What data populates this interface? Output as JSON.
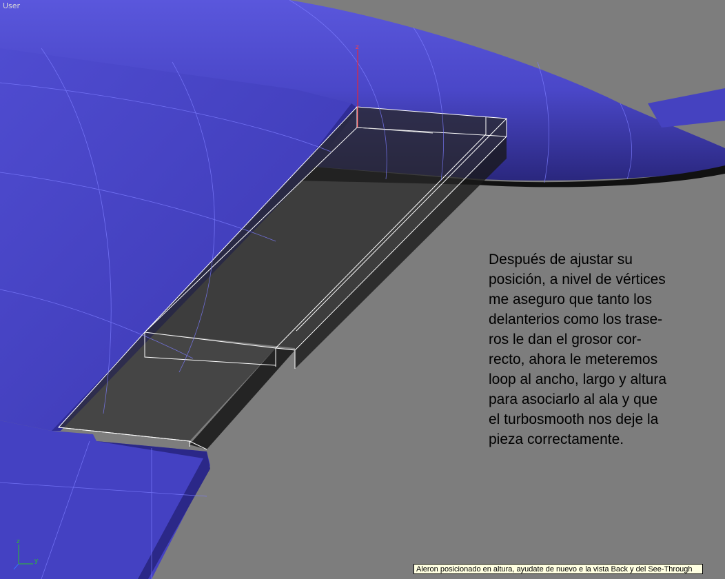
{
  "viewport": {
    "label": "User",
    "axis_labels": {
      "z": "z",
      "y": "y",
      "x": "x"
    }
  },
  "annotation": {
    "text": "Después de ajustar su\nposición, a nivel de vértices\nme aseguro que tanto los\ndelanterios como los trase-\nros le dan el grosor cor-\nrecto, ahora le meteremos\nloop al ancho, largo y altura\npara asociarlo al ala y que\nel turbosmooth nos deje la\npieza correctamente."
  },
  "tooltip": {
    "text": "Aleron posicionado en altura, ayudate de nuevo e la vista Back y del See-Through"
  },
  "colors": {
    "background": "#7d7d7d",
    "mesh": "#4a47c8",
    "mesh_dark": "#2d2a8a",
    "wire": "#7c7cff",
    "selected_wire": "#ffffff",
    "axis_z": "#ff2020"
  }
}
